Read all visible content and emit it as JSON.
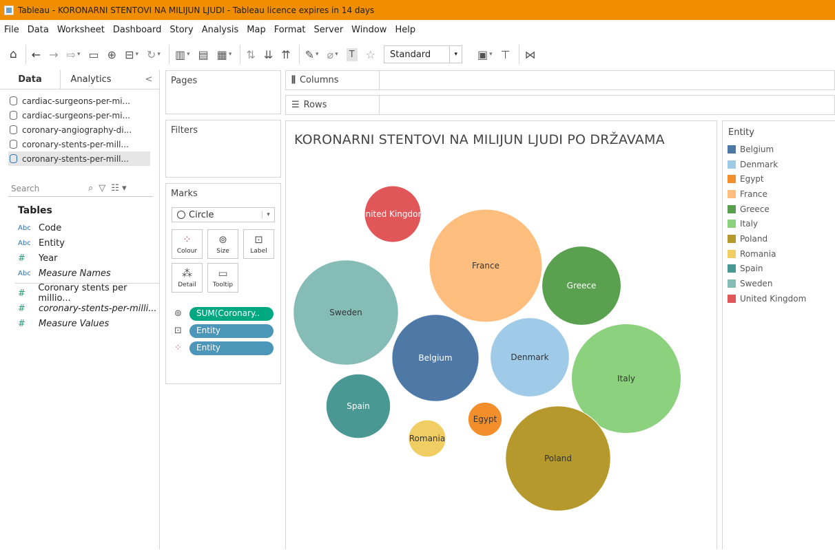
{
  "window": {
    "title": "Tableau - KORONARNI STENTOVI NA MILIJUN LJUDI - Tableau licence expires in 14 days"
  },
  "menu": [
    "File",
    "Data",
    "Worksheet",
    "Dashboard",
    "Story",
    "Analysis",
    "Map",
    "Format",
    "Server",
    "Window",
    "Help"
  ],
  "toolbar": {
    "fit_select": "Standard"
  },
  "left_pane": {
    "tabs": {
      "data": "Data",
      "analytics": "Analytics",
      "close": "<"
    },
    "datasources": [
      "cardiac-surgeons-per-mi...",
      "cardiac-surgeons-per-mi...",
      "coronary-angiography-di...",
      "coronary-stents-per-mill...",
      "coronary-stents-per-mill..."
    ],
    "search_placeholder": "Search",
    "tables_heading": "Tables",
    "fields": [
      {
        "type": "Abc",
        "name": "Code"
      },
      {
        "type": "Abc",
        "name": "Entity"
      },
      {
        "type": "#",
        "name": "Year"
      },
      {
        "type": "Abc",
        "name": "Measure Names"
      },
      {
        "type": "#",
        "name": "Coronary stents per millio..."
      },
      {
        "type": "#",
        "name": "coronary-stents-per-milli..."
      },
      {
        "type": "#",
        "name": "Measure Values"
      }
    ]
  },
  "cards": {
    "pages": "Pages",
    "filters": "Filters",
    "marks": "Marks",
    "mark_type": "Circle",
    "mark_buttons": {
      "colour": "Colour",
      "size": "Size",
      "label": "Label",
      "detail": "Detail",
      "tooltip": "Tooltip"
    },
    "pills": {
      "size": "SUM(Coronary..",
      "label": "Entity",
      "colour": "Entity"
    }
  },
  "shelves": {
    "columns": "Columns",
    "rows": "Rows"
  },
  "view": {
    "title": "KORONARNI STENTOVI NA MILIJUN LJUDI PO DRŽAVAMA"
  },
  "legend": {
    "title": "Entity",
    "items": [
      {
        "name": "Belgium",
        "color": "#4e79a7"
      },
      {
        "name": "Denmark",
        "color": "#a0cbe8"
      },
      {
        "name": "Egypt",
        "color": "#f28e2b"
      },
      {
        "name": "France",
        "color": "#ffbe7d"
      },
      {
        "name": "Greece",
        "color": "#59a14f"
      },
      {
        "name": "Italy",
        "color": "#8cd17d"
      },
      {
        "name": "Poland",
        "color": "#b6992d"
      },
      {
        "name": "Romania",
        "color": "#f1ce63"
      },
      {
        "name": "Spain",
        "color": "#499894"
      },
      {
        "name": "Sweden",
        "color": "#86bcb6"
      },
      {
        "name": "United Kingdom",
        "color": "#e15759"
      }
    ]
  },
  "chart_data": {
    "type": "bubble",
    "title": "KORONARNI STENTOVI NA MILIJUN LJUDI PO DRŽAVAMA",
    "size_measure": "SUM(Coronary..",
    "bubbles": [
      {
        "name": "France",
        "relative_size": 1.0,
        "color": "#ffbe7d",
        "label_color": "#333333"
      },
      {
        "name": "Italy",
        "relative_size": 0.97,
        "color": "#8cd17d",
        "label_color": "#333333"
      },
      {
        "name": "Poland",
        "relative_size": 0.93,
        "color": "#b6992d",
        "label_color": "#333333"
      },
      {
        "name": "Sweden",
        "relative_size": 0.93,
        "color": "#86bcb6",
        "label_color": "#333333"
      },
      {
        "name": "Belgium",
        "relative_size": 0.77,
        "color": "#4e79a7",
        "label_color": "#ffffff"
      },
      {
        "name": "Denmark",
        "relative_size": 0.7,
        "color": "#a0cbe8",
        "label_color": "#333333"
      },
      {
        "name": "Greece",
        "relative_size": 0.7,
        "color": "#59a14f",
        "label_color": "#ffffff"
      },
      {
        "name": "Spain",
        "relative_size": 0.57,
        "color": "#499894",
        "label_color": "#ffffff"
      },
      {
        "name": "United Kingdom",
        "relative_size": 0.5,
        "color": "#e15759",
        "label_color": "#ffffff"
      },
      {
        "name": "Romania",
        "relative_size": 0.33,
        "color": "#f1ce63",
        "label_color": "#333333"
      },
      {
        "name": "Egypt",
        "relative_size": 0.3,
        "color": "#f28e2b",
        "label_color": "#333333"
      }
    ]
  }
}
